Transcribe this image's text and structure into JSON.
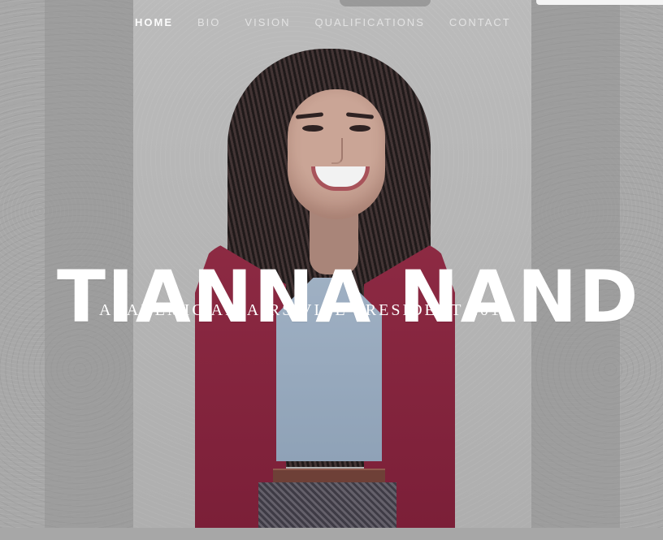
{
  "navigation": {
    "items": [
      {
        "label": "HOME"
      },
      {
        "label": "BIO"
      },
      {
        "label": "VISION"
      },
      {
        "label": "QUALIFICATIONS"
      },
      {
        "label": "CONTACT"
      }
    ]
  },
  "hero": {
    "title": "TIANNA NAND",
    "subtitle": "ACADEMIC AFFAIRS VICE PRESIDENT 2016",
    "image_alt": "Smiling woman with long curly hair wearing a red blazer"
  },
  "colors": {
    "nav_active": "#ffffff",
    "nav_inactive": "#f2f2f2",
    "jacket": "#8d2a43",
    "overlay": "#aaaaaa"
  }
}
